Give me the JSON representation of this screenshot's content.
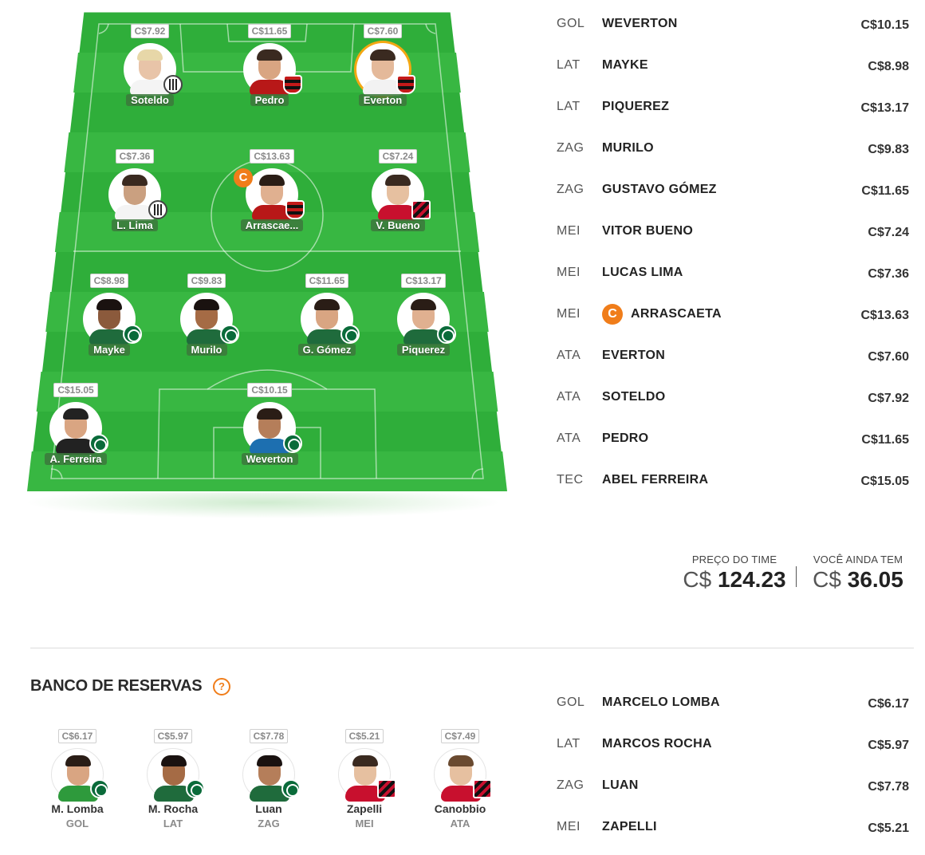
{
  "colors": {
    "pitch": "#2fae3a",
    "pitch_light": "#3fbf48",
    "accent": "#f07d1a",
    "captain_ring": "#f3a712"
  },
  "pitch_players": [
    {
      "id": "soteldo",
      "name": "Soteldo",
      "price": "C$7.92",
      "club": "santos",
      "skin": "#e8c4a8",
      "hair": "#e7d7a8",
      "shirt": "#f4f4f4"
    },
    {
      "id": "pedro",
      "name": "Pedro",
      "price": "C$11.65",
      "club": "flamengo",
      "skin": "#d9a582",
      "hair": "#3a2a20",
      "shirt": "#b81818"
    },
    {
      "id": "everton",
      "name": "Everton",
      "price": "C$7.60",
      "club": "flamengo",
      "skin": "#e4b99a",
      "hair": "#3a2a20",
      "shirt": "#f2f2f2",
      "ring": true
    },
    {
      "id": "lima",
      "name": "L. Lima",
      "price": "C$7.36",
      "club": "santos",
      "skin": "#caa080",
      "hair": "#3a2a20",
      "shirt": "#f4f4f4"
    },
    {
      "id": "arrascaeta",
      "name": "Arrascae...",
      "price": "C$13.63",
      "club": "flamengo",
      "skin": "#e0b090",
      "hair": "#2a1d16",
      "shirt": "#b81818",
      "captain": true
    },
    {
      "id": "bueno",
      "name": "V. Bueno",
      "price": "C$7.24",
      "club": "athletico",
      "skin": "#e6c0a0",
      "hair": "#3a2a20",
      "shirt": "#c8102e"
    },
    {
      "id": "mayke",
      "name": "Mayke",
      "price": "C$8.98",
      "club": "palmeiras",
      "skin": "#8b5a3c",
      "hair": "#1a1210",
      "shirt": "#1f6b3c"
    },
    {
      "id": "murilo",
      "name": "Murilo",
      "price": "C$9.83",
      "club": "palmeiras",
      "skin": "#a56b45",
      "hair": "#1a1210",
      "shirt": "#1f6b3c"
    },
    {
      "id": "gomez",
      "name": "G. Gómez",
      "price": "C$11.65",
      "club": "palmeiras",
      "skin": "#d9a582",
      "hair": "#2a1d16",
      "shirt": "#1f6b3c"
    },
    {
      "id": "piquerez",
      "name": "Piquerez",
      "price": "C$13.17",
      "club": "palmeiras",
      "skin": "#e0b090",
      "hair": "#2a1d16",
      "shirt": "#1f6b3c"
    },
    {
      "id": "ferreira",
      "name": "A. Ferreira",
      "price": "C$15.05",
      "club": "palmeiras",
      "skin": "#d9a582",
      "hair": "#222222",
      "shirt": "#222222"
    },
    {
      "id": "weverton",
      "name": "Weverton",
      "price": "C$10.15",
      "club": "palmeiras",
      "skin": "#b57e5a",
      "hair": "#2a1d16",
      "shirt": "#1d6fb0"
    }
  ],
  "captain_letter": "C",
  "lineup": [
    {
      "pos": "GOL",
      "name": "WEVERTON",
      "price": "C$10.15"
    },
    {
      "pos": "LAT",
      "name": "MAYKE",
      "price": "C$8.98"
    },
    {
      "pos": "LAT",
      "name": "PIQUEREZ",
      "price": "C$13.17"
    },
    {
      "pos": "ZAG",
      "name": "MURILO",
      "price": "C$9.83"
    },
    {
      "pos": "ZAG",
      "name": "GUSTAVO GÓMEZ",
      "price": "C$11.65"
    },
    {
      "pos": "MEI",
      "name": "VITOR BUENO",
      "price": "C$7.24"
    },
    {
      "pos": "MEI",
      "name": "LUCAS LIMA",
      "price": "C$7.36"
    },
    {
      "pos": "MEI",
      "name": "ARRASCAETA",
      "price": "C$13.63",
      "captain": true
    },
    {
      "pos": "ATA",
      "name": "EVERTON",
      "price": "C$7.60"
    },
    {
      "pos": "ATA",
      "name": "SOTELDO",
      "price": "C$7.92"
    },
    {
      "pos": "ATA",
      "name": "PEDRO",
      "price": "C$11.65"
    },
    {
      "pos": "TEC",
      "name": "ABEL FERREIRA",
      "price": "C$15.05"
    }
  ],
  "totals": {
    "team_price_label": "PREÇO DO TIME",
    "team_price_currency": "C$",
    "team_price_value": "124.23",
    "remaining_label": "VOCÊ AINDA TEM",
    "remaining_currency": "C$",
    "remaining_value": "36.05"
  },
  "bench": {
    "title": "BANCO DE RESERVAS",
    "help_label": "?",
    "players": [
      {
        "name": "M. Lomba",
        "pos": "GOL",
        "price": "C$6.17",
        "club": "palmeiras",
        "skin": "#d9a582",
        "hair": "#2a1d16",
        "shirt": "#2e9a3c"
      },
      {
        "name": "M. Rocha",
        "pos": "LAT",
        "price": "C$5.97",
        "club": "palmeiras",
        "skin": "#a56b45",
        "hair": "#1a1210",
        "shirt": "#1f6b3c"
      },
      {
        "name": "Luan",
        "pos": "ZAG",
        "price": "C$7.78",
        "club": "palmeiras",
        "skin": "#b57e5a",
        "hair": "#1a1210",
        "shirt": "#1f6b3c"
      },
      {
        "name": "Zapelli",
        "pos": "MEI",
        "price": "C$5.21",
        "club": "athletico",
        "skin": "#e6c0a0",
        "hair": "#3a2a20",
        "shirt": "#c8102e"
      },
      {
        "name": "Canobbio",
        "pos": "ATA",
        "price": "C$7.49",
        "club": "athletico",
        "skin": "#e6c0a0",
        "hair": "#6a4a30",
        "shirt": "#c8102e"
      }
    ],
    "list": [
      {
        "pos": "GOL",
        "name": "MARCELO LOMBA",
        "price": "C$6.17"
      },
      {
        "pos": "LAT",
        "name": "MARCOS ROCHA",
        "price": "C$5.97"
      },
      {
        "pos": "ZAG",
        "name": "LUAN",
        "price": "C$7.78"
      },
      {
        "pos": "MEI",
        "name": "ZAPELLI",
        "price": "C$5.21"
      }
    ]
  }
}
